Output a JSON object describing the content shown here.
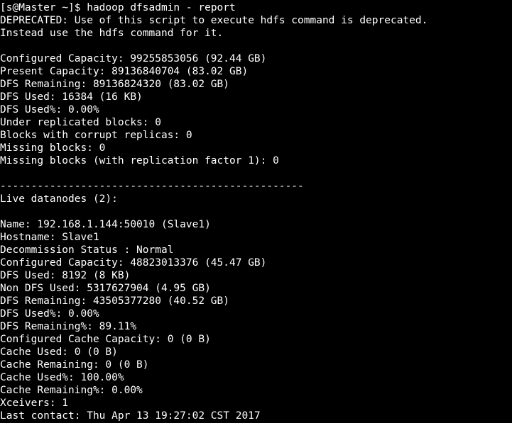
{
  "prompt": "[s@Master ~]$ ",
  "command": "hadoop dfsadmin - report",
  "lines": [
    "DEPRECATED: Use of this script to execute hdfs command is deprecated.",
    "Instead use the hdfs command for it.",
    "",
    "Configured Capacity: 99255853056 (92.44 GB)",
    "Present Capacity: 89136840704 (83.02 GB)",
    "DFS Remaining: 89136824320 (83.02 GB)",
    "DFS Used: 16384 (16 KB)",
    "DFS Used%: 0.00%",
    "Under replicated blocks: 0",
    "Blocks with corrupt replicas: 0",
    "Missing blocks: 0",
    "Missing blocks (with replication factor 1): 0",
    "",
    "-------------------------------------------------",
    "Live datanodes (2):",
    "",
    "Name: 192.168.1.144:50010 (Slave1)",
    "Hostname: Slave1",
    "Decommission Status : Normal",
    "Configured Capacity: 48823013376 (45.47 GB)",
    "DFS Used: 8192 (8 KB)",
    "Non DFS Used: 5317627904 (4.95 GB)",
    "DFS Remaining: 43505377280 (40.52 GB)",
    "DFS Used%: 0.00%",
    "DFS Remaining%: 89.11%",
    "Configured Cache Capacity: 0 (0 B)",
    "Cache Used: 0 (0 B)",
    "Cache Remaining: 0 (0 B)",
    "Cache Used%: 100.00%",
    "Cache Remaining%: 0.00%",
    "Xceivers: 1",
    "Last contact: Thu Apr 13 19:27:02 CST 2017"
  ]
}
